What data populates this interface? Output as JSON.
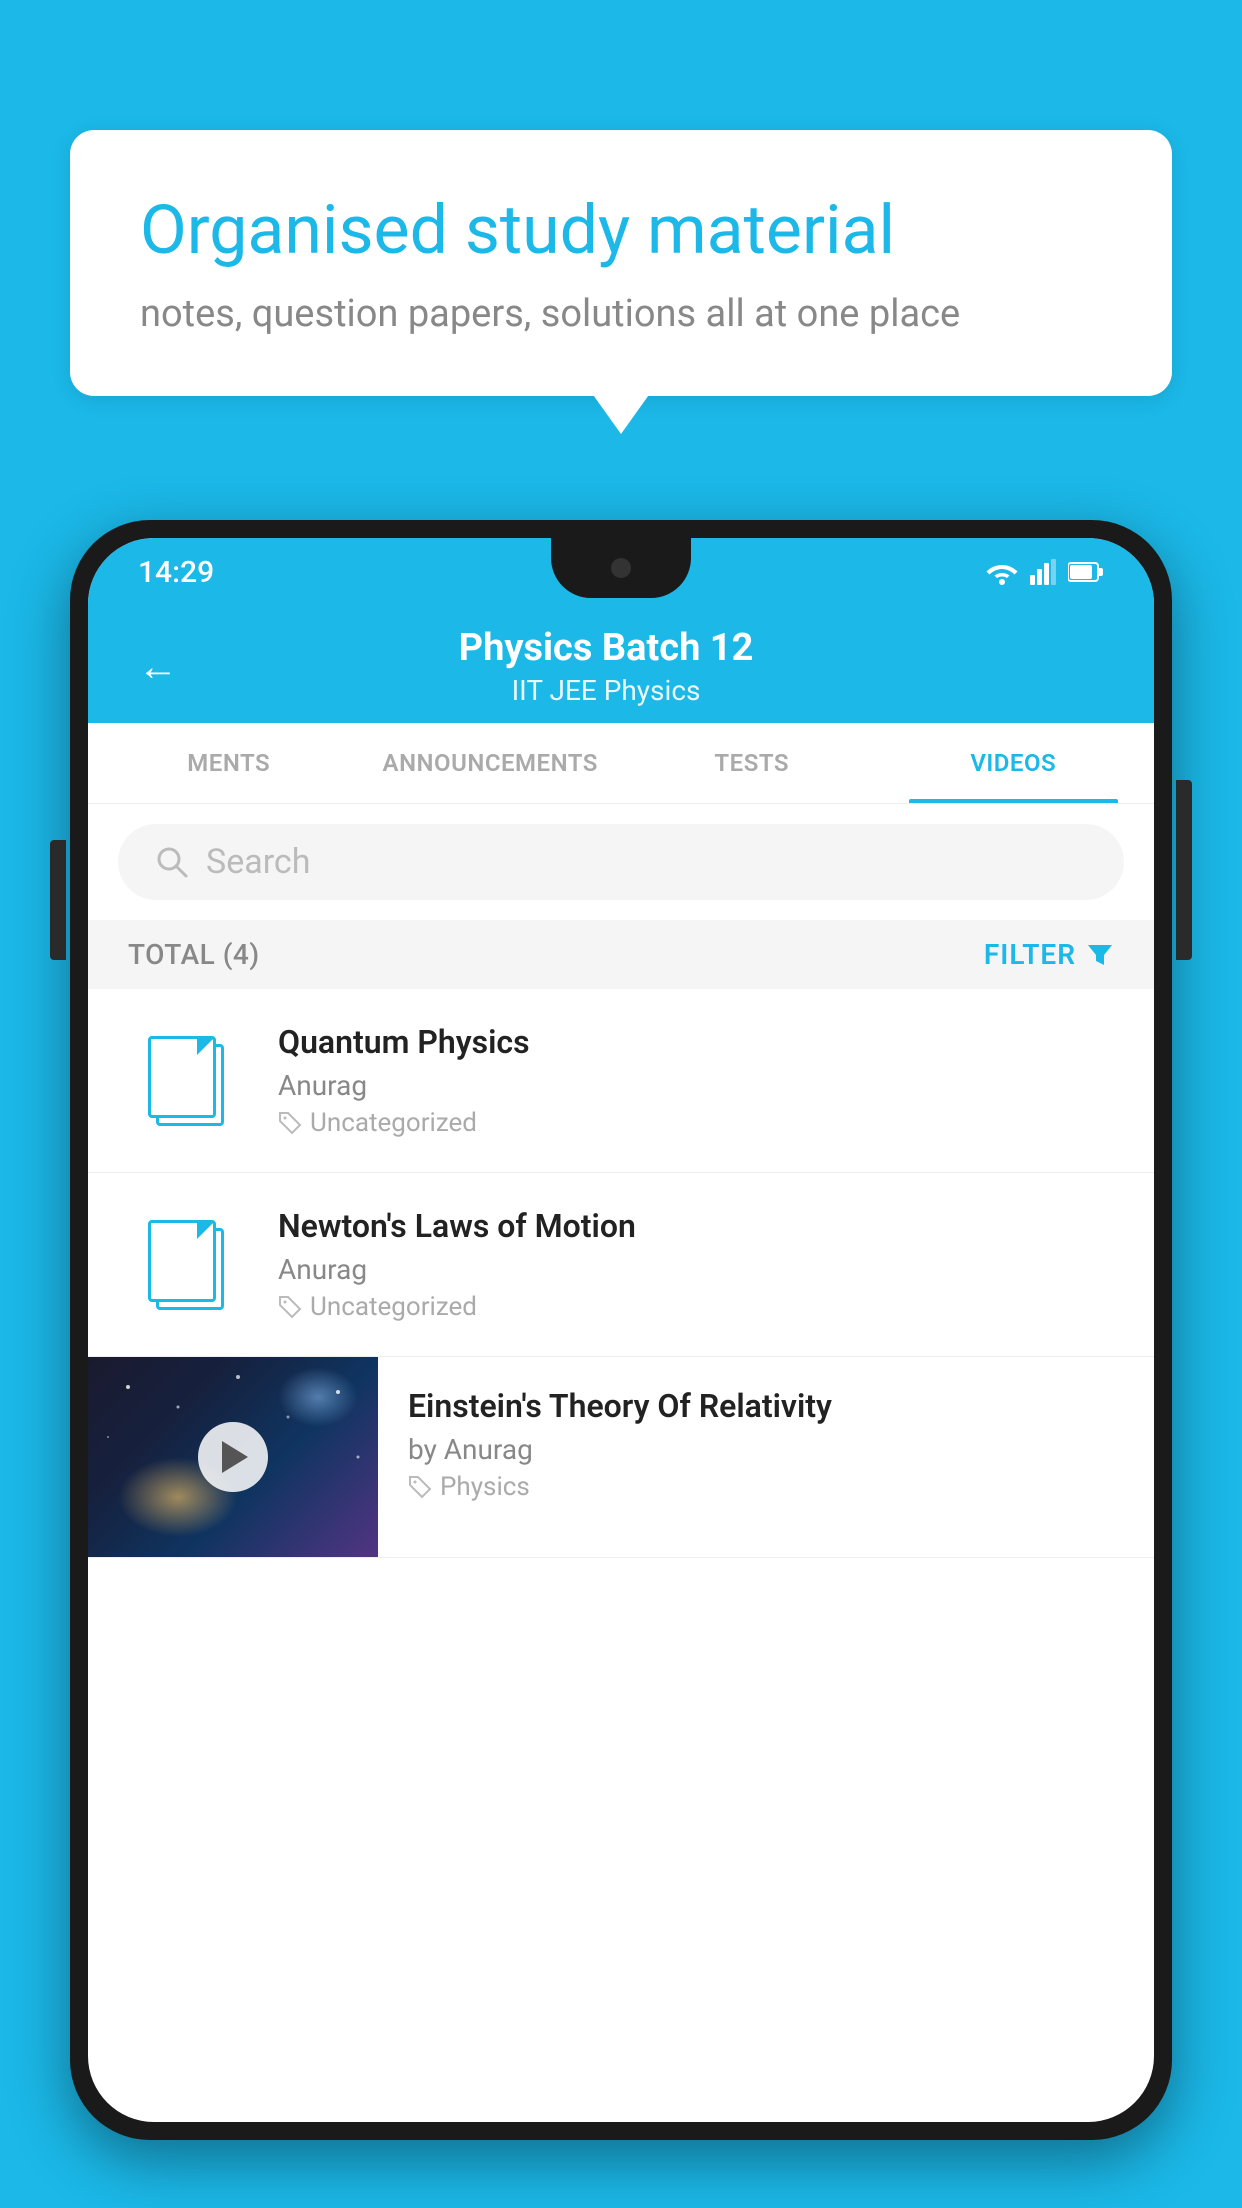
{
  "background_color": "#1bb8e8",
  "speech_bubble": {
    "title": "Organised study material",
    "subtitle": "notes, question papers, solutions all at one place"
  },
  "phone": {
    "status_bar": {
      "time": "14:29",
      "icons": [
        "wifi",
        "signal",
        "battery"
      ]
    },
    "header": {
      "back_label": "←",
      "title": "Physics Batch 12",
      "subtitle_tags": "IIT JEE    Physics"
    },
    "tabs": [
      {
        "label": "MENTS",
        "active": false
      },
      {
        "label": "ANNOUNCEMENTS",
        "active": false
      },
      {
        "label": "TESTS",
        "active": false
      },
      {
        "label": "VIDEOS",
        "active": true
      }
    ],
    "search": {
      "placeholder": "Search"
    },
    "filter_row": {
      "total_label": "TOTAL (4)",
      "filter_label": "FILTER"
    },
    "videos": [
      {
        "id": "quantum",
        "title": "Quantum Physics",
        "author": "Anurag",
        "tag": "Uncategorized",
        "has_thumb": false
      },
      {
        "id": "newton",
        "title": "Newton's Laws of Motion",
        "author": "Anurag",
        "tag": "Uncategorized",
        "has_thumb": false
      },
      {
        "id": "einstein",
        "title": "Einstein's Theory Of Relativity",
        "author": "by Anurag",
        "tag": "Physics",
        "has_thumb": true
      }
    ]
  }
}
